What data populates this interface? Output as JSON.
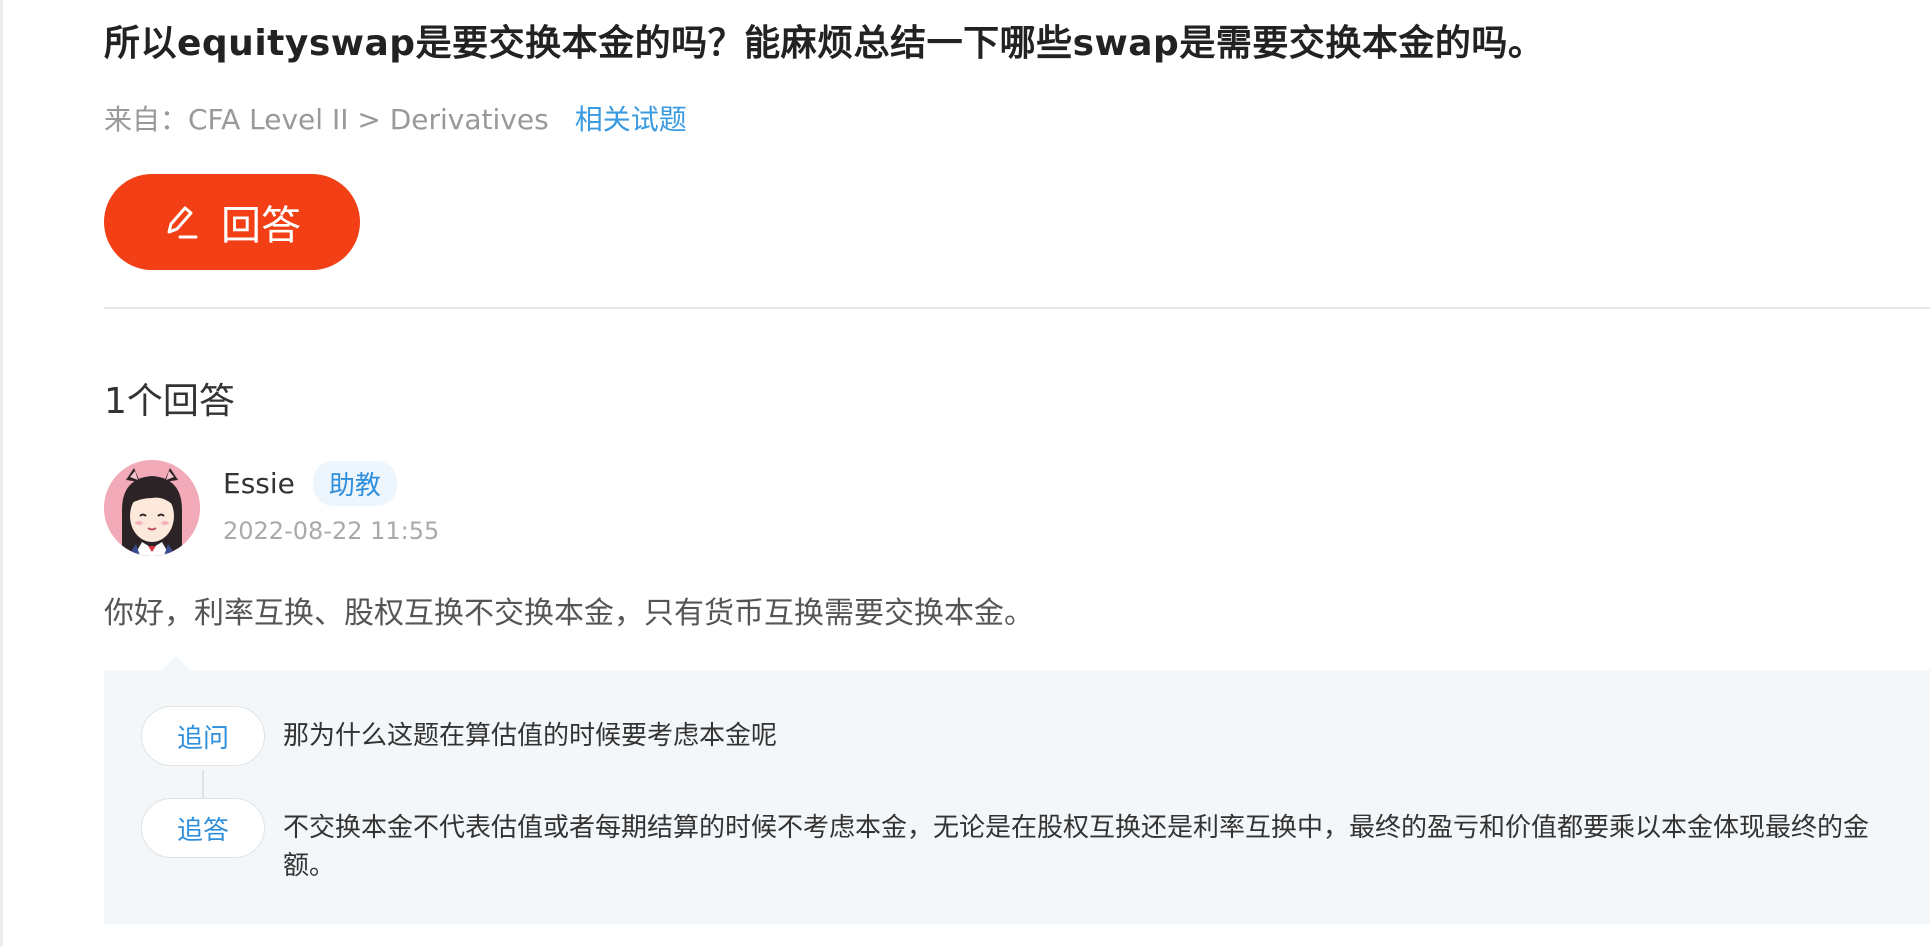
{
  "question": {
    "title": "所以equityswap是要交换本金的吗？能麻烦总结一下哪些swap是需要交换本金的吗。",
    "source_prefix": "来自：CFA Level II > Derivatives",
    "related_link": "相关试题"
  },
  "actions": {
    "answer_button": "回答",
    "answer_icon": "pencil-icon"
  },
  "answers": {
    "count_label": "1个回答",
    "items": [
      {
        "author": "Essie",
        "role_badge": "助教",
        "time": "2022-08-22 11:55",
        "text": "你好，利率互换、股权互换不交换本金，只有货币互换需要交换本金。",
        "followups": [
          {
            "tag": "追问",
            "text": "那为什么这题在算估值的时候要考虑本金呢"
          },
          {
            "tag": "追答",
            "text": "不交换本金不代表估值或者每期结算的时候不考虑本金，无论是在股权互换还是利率互换中，最终的盈亏和价值都要乘以本金体现最终的金额。"
          }
        ]
      }
    ]
  },
  "colors": {
    "accent": "#f23f15",
    "link": "#3a9be0",
    "badge_bg": "#eef6fd",
    "followup_bg": "#f4f7f9"
  }
}
